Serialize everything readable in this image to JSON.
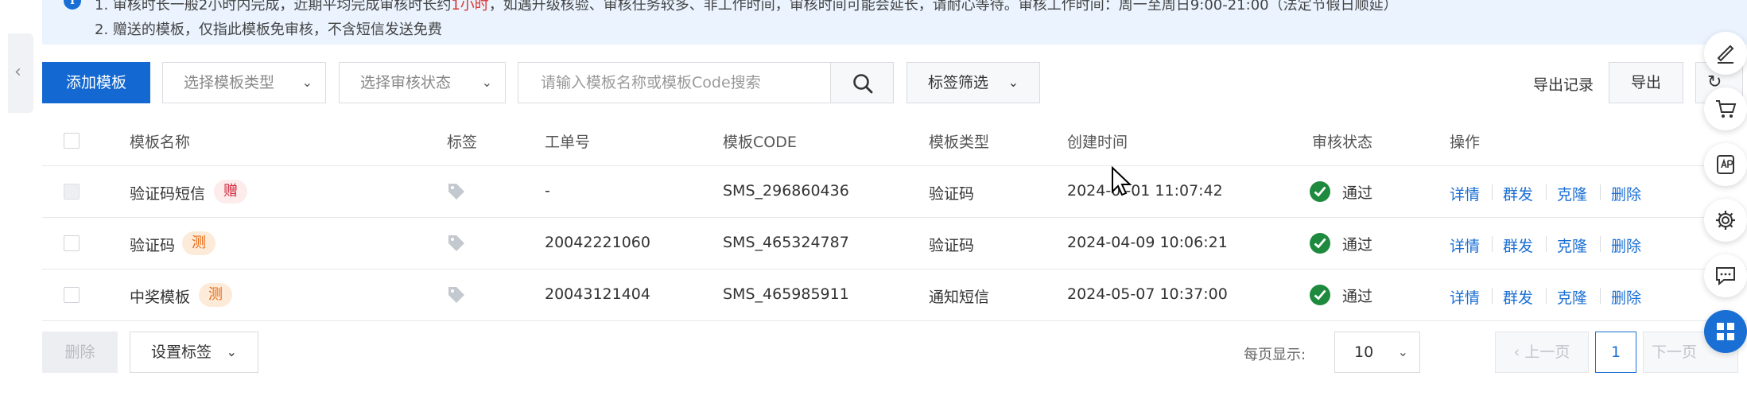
{
  "notice": {
    "line1_prefix": "1. 审核时长一般2小时内完成，近期平均完成审核时长约",
    "line1_highlight": "1小时",
    "line1_suffix": "，如遇升级核验、审核任务较多、非工作时间，审核时间可能会延长，请耐心等待。审核工作时间：周一至周日9:00-21:00（法定节假日顺延）",
    "line2": "2. 赠送的模板，仅指此模板免审核，不含短信发送免费"
  },
  "toolbar": {
    "add_label": "添加模板",
    "type_placeholder": "选择模板类型",
    "status_placeholder": "选择审核状态",
    "search_placeholder": "请输入模板名称或模板Code搜索",
    "tag_filter_label": "标签筛选",
    "export_log_label": "导出记录",
    "export_label": "导出"
  },
  "table": {
    "headers": {
      "name": "模板名称",
      "tag": "标签",
      "ticket": "工单号",
      "code": "模板CODE",
      "type": "模板类型",
      "created": "创建时间",
      "status": "审核状态",
      "actions": "操作"
    },
    "rows": [
      {
        "name": "验证码短信",
        "badge": "赠",
        "badge_kind": "gift",
        "ticket": "-",
        "code": "SMS_296860436",
        "type": "验证码",
        "created": "2024-0 -01 11:07:42",
        "status": "通过"
      },
      {
        "name": "验证码",
        "badge": "测",
        "badge_kind": "test",
        "ticket": "20042221060",
        "code": "SMS_465324787",
        "type": "验证码",
        "created": "2024-04-09 10:06:21",
        "status": "通过"
      },
      {
        "name": "中奖模板",
        "badge": "测",
        "badge_kind": "test",
        "ticket": "20043121404",
        "code": "SMS_465985911",
        "type": "通知短信",
        "created": "2024-05-07 10:37:00",
        "status": "通过"
      }
    ],
    "actions": {
      "detail": "详情",
      "mass_send": "群发",
      "clone": "克隆",
      "delete": "删除"
    }
  },
  "footer": {
    "delete_label": "删除",
    "set_tag_label": "设置标签",
    "per_page_label": "每页显示:",
    "per_page_value": "10",
    "prev_label": "上一页",
    "current_page": "1",
    "next_label": "下一页"
  },
  "colors": {
    "primary": "#1368d1",
    "link": "#1a6fd4",
    "success": "#1e8a3e",
    "gift_badge": "#d0263b",
    "test_badge": "#e86a15",
    "notice_bg": "#eaf3fe"
  }
}
